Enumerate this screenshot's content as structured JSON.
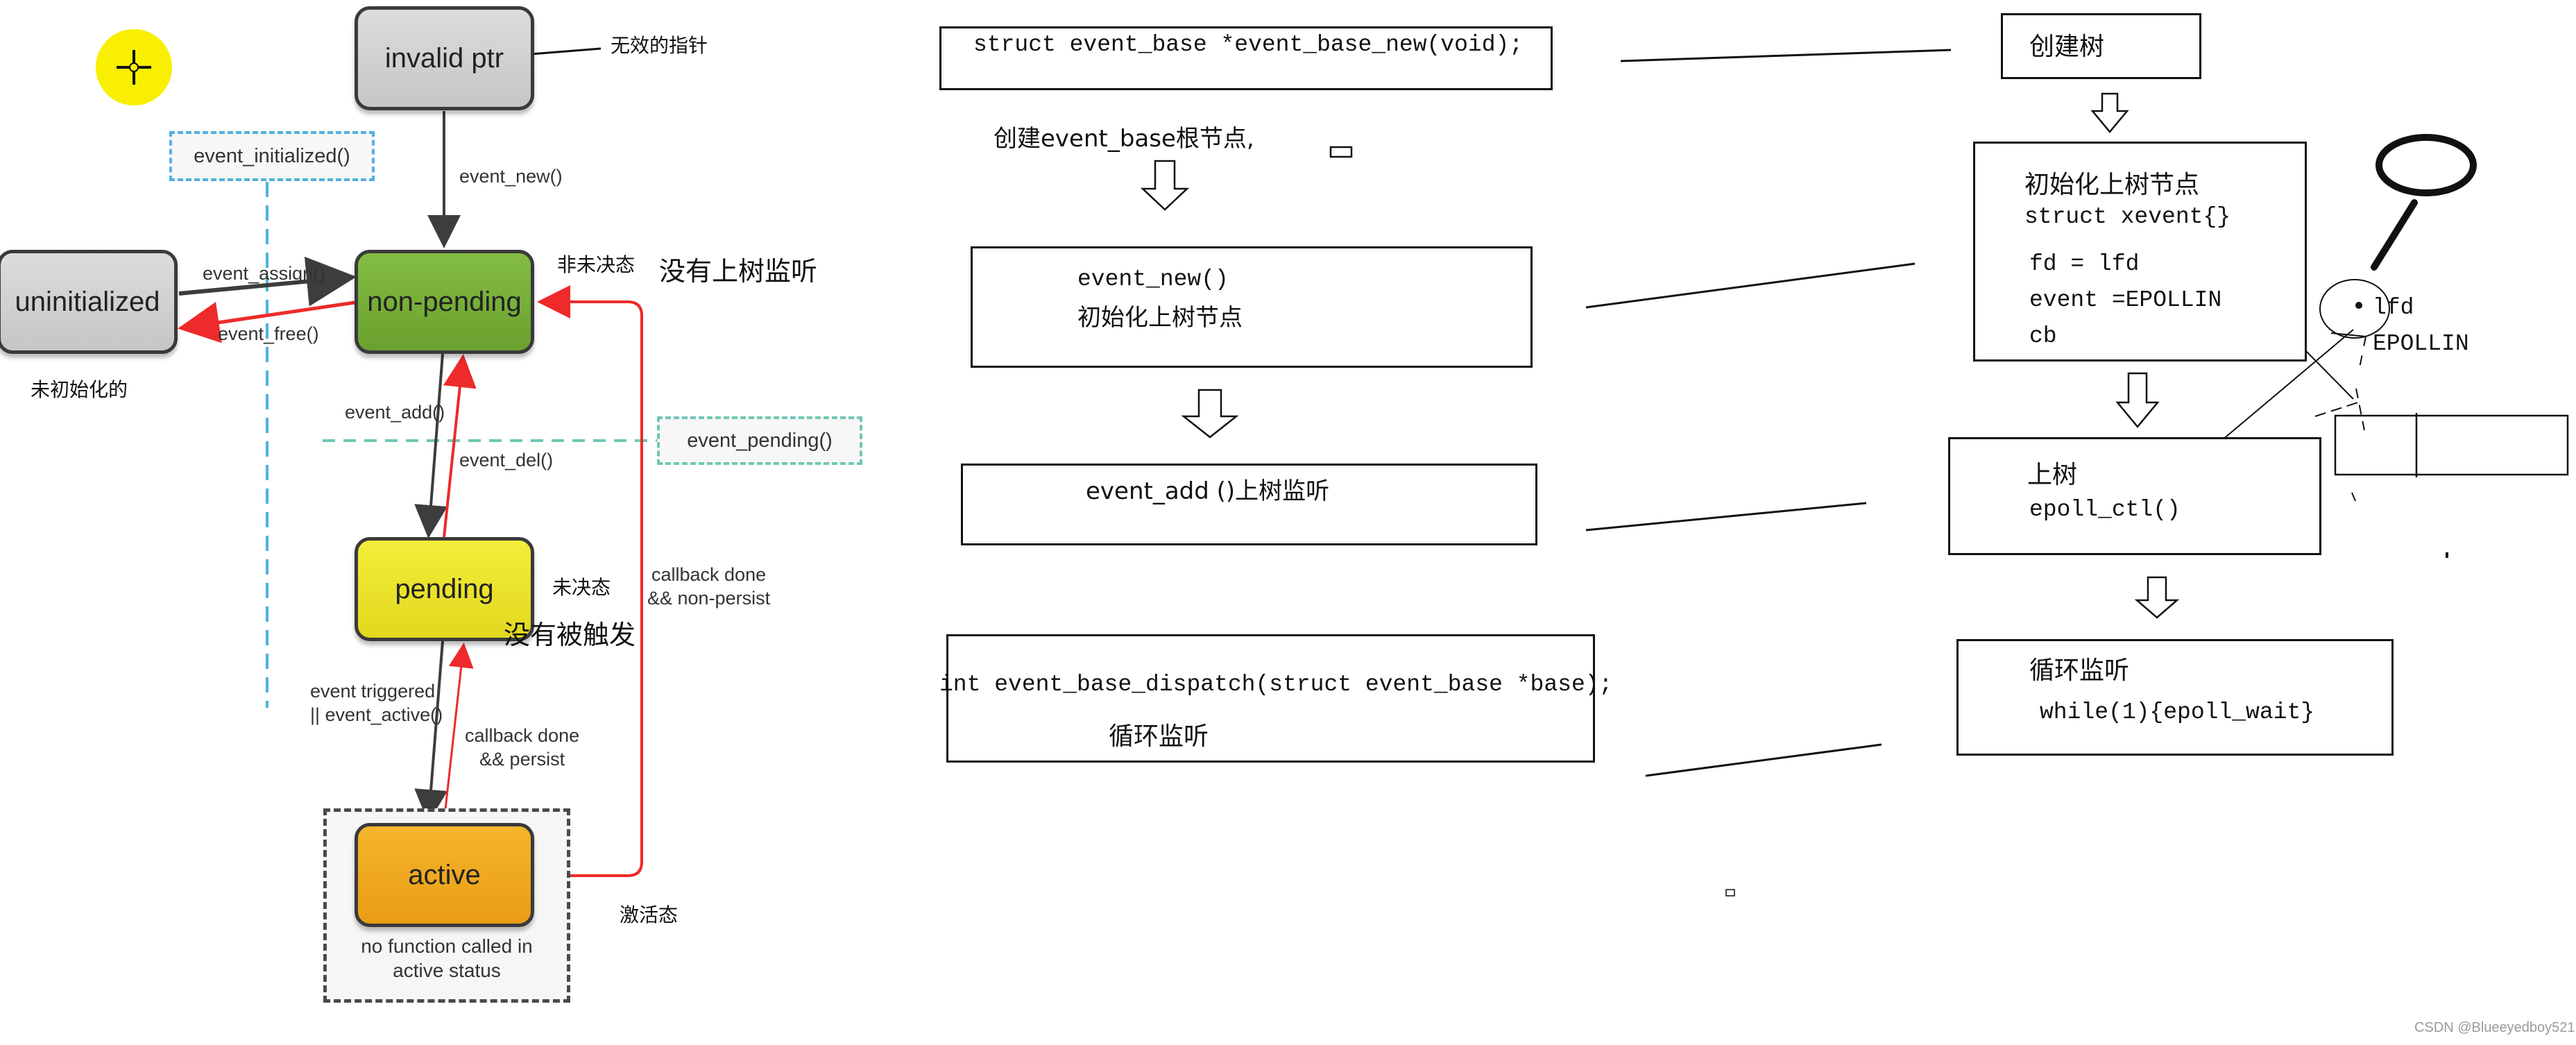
{
  "state_diagram": {
    "states": {
      "invalid_ptr": "invalid ptr",
      "uninitialized": "uninitialized",
      "non_pending": "non-pending",
      "pending": "pending",
      "active": "active"
    },
    "transitions": {
      "event_new": "event_new()",
      "event_assign": "event_assign()",
      "event_free": "event_free()",
      "event_add": "event_add()",
      "event_del": "event_del()",
      "event_triggered_line1": "event triggered",
      "event_triggered_line2": "|| event_active()",
      "callback_persist_line1": "callback done",
      "callback_persist_line2": "&& persist",
      "callback_nonpersist_line1": "callback done",
      "callback_nonpersist_line2": "&& non-persist"
    },
    "query_functions": {
      "event_initialized": "event_initialized()",
      "event_pending": "event_pending()"
    },
    "active_note_line1": "no function called in",
    "active_note_line2": "active status",
    "annotations": {
      "invalid_ptr_cn": "无效的指针",
      "uninitialized_cn": "未初始化的",
      "non_pending_cn": "非未决态",
      "non_pending_note": "没有上树监听",
      "pending_cn": "未决态",
      "pending_note": "没有被触发",
      "active_cn": "激活态"
    }
  },
  "api_flow": {
    "event_base_new": "struct event_base *event_base_new(void);",
    "event_base_new_note": "创建event_base根节点,",
    "event_new": "event_new()",
    "event_new_note": "初始化上树节点",
    "event_add": "event_add ()上树监听",
    "dispatch": "int event_base_dispatch(struct event_base *base);",
    "dispatch_note": "循环监听"
  },
  "epoll_flow": {
    "create_tree": "创建树",
    "init_node_title": "初始化上树节点",
    "init_node_struct": "struct xevent{}",
    "init_node_fd": "fd = lfd",
    "init_node_event": "event =EPOLLIN",
    "init_node_cb": "cb",
    "add_tree_title": "上树",
    "add_tree_call": "epoll_ctl()",
    "loop_title": "循环监听",
    "loop_call": "while(1){epoll_wait}",
    "node_lfd": "lfd",
    "node_epollin": "EPOLLIN"
  },
  "cursor": {
    "icon": "crosshair-cursor-icon",
    "highlight_color": "#f8f000"
  },
  "watermark": "CSDN @Blueeyedboy521",
  "colors": {
    "arrow_dark": "#3d3d3d",
    "arrow_red": "#ee2a2a",
    "dash_blue": "#4fb3dc",
    "dash_teal": "#6ec8b4"
  }
}
